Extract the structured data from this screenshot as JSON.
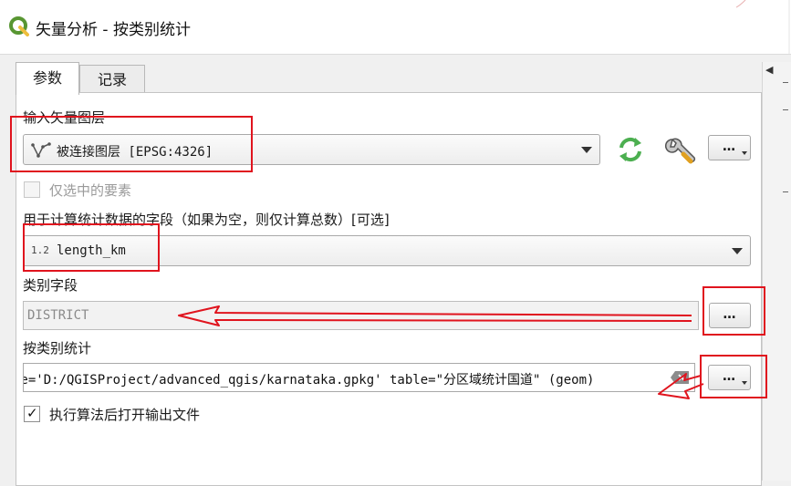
{
  "window": {
    "title": "矢量分析 - 按类别统计",
    "logo_icon": "qgis-logo-icon"
  },
  "tabs": [
    {
      "label": "参数",
      "active": true
    },
    {
      "label": "记录",
      "active": false
    }
  ],
  "input_layer": {
    "label": "输入矢量图层",
    "value": "被连接图层 [EPSG:4326]",
    "icon": "line-layer-icon",
    "buttons": {
      "iterate_icon": "iterate-icon",
      "settings_icon": "wrench-icon",
      "more_label": "…"
    }
  },
  "selected_only": {
    "label": "仅选中的要素",
    "checked": false,
    "enabled": false
  },
  "stats_field": {
    "label": "用于计算统计数据的字段（如果为空，则仅计算总数）[可选]",
    "type_badge": "1.2",
    "value": "length_km"
  },
  "category_field": {
    "label": "类别字段",
    "value": "DISTRICT",
    "button_label": "…"
  },
  "output": {
    "label": "按类别统计",
    "value": "ne='D:/QGISProject/advanced_qgis/karnataka.gpkg' table=\"分区域统计国道\" (geom)",
    "button_label": "…"
  },
  "open_output": {
    "label": "执行算法后打开输出文件",
    "checked": true
  },
  "colors": {
    "annotation_red": "#e0141e",
    "qgis_green": "#589632",
    "qgis_yellow": "#eebe3d"
  }
}
